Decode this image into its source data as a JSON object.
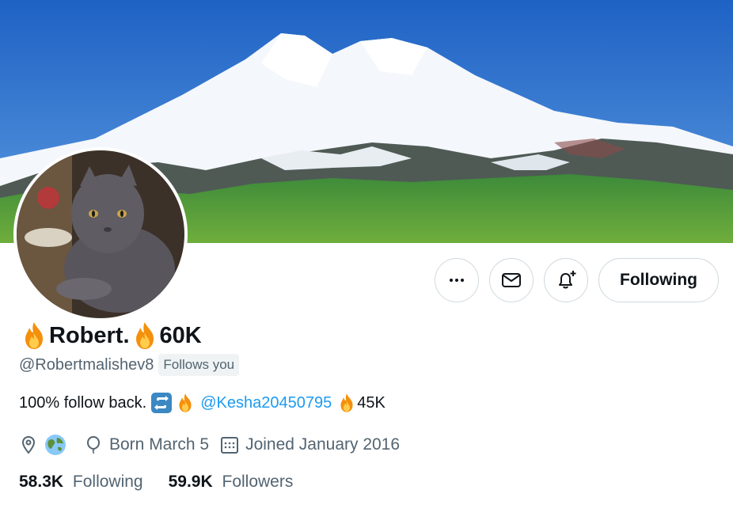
{
  "profile": {
    "name_part1": "Robert.",
    "name_part2": "60K",
    "handle": "@Robertmalishev8",
    "follows_you": "Follows you",
    "bio": {
      "text": "100% follow back.",
      "mention": "@Kesha20450795",
      "suffix": "45K"
    },
    "meta": {
      "birthday": "Born March 5",
      "joined": "Joined January 2016"
    },
    "stats": {
      "following_count": "58.3K",
      "following_label": "Following",
      "followers_count": "59.9K",
      "followers_label": "Followers"
    }
  },
  "actions": {
    "more_icon": "more-icon",
    "message_icon": "envelope-icon",
    "notify_icon": "bell-plus-icon",
    "follow_label": "Following"
  },
  "colors": {
    "accent": "#1d9bf0",
    "secondary_text": "#536471",
    "border": "#cfd9de",
    "sky": "#2a6fc9"
  }
}
